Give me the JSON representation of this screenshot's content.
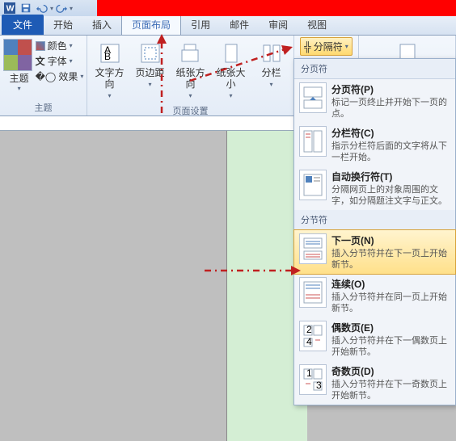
{
  "tabs": {
    "file": "文件",
    "home": "开始",
    "insert": "插入",
    "layout": "页面布局",
    "ref": "引用",
    "mail": "邮件",
    "review": "审阅",
    "view": "视图"
  },
  "theme": {
    "label": "主题",
    "colors": "颜色",
    "fonts": "字体",
    "effects": "效果",
    "group": "主题"
  },
  "pagesetup": {
    "textdir": "文字方向",
    "margins": "页边距",
    "orient": "纸张方向",
    "size": "纸张大小",
    "columns": "分栏",
    "group": "页面设置",
    "breaks": "分隔符"
  },
  "dd": {
    "h1": "分页符",
    "i1t": "分页符(P)",
    "i1d": "标记一页终止并开始下一页的点。",
    "i2t": "分栏符(C)",
    "i2d": "指示分栏符后面的文字将从下一栏开始。",
    "i3t": "自动换行符(T)",
    "i3d": "分隔网页上的对象周围的文字，如分隔题注文字与正文。",
    "h2": "分节符",
    "i4t": "下一页(N)",
    "i4d": "插入分节符并在下一页上开始新节。",
    "i5t": "连续(O)",
    "i5d": "插入分节符并在同一页上开始新节。",
    "i6t": "偶数页(E)",
    "i6d": "插入分节符并在下一偶数页上开始新节。",
    "i7t": "奇数页(D)",
    "i7d": "插入分节符并在下一奇数页上开始新节。"
  }
}
